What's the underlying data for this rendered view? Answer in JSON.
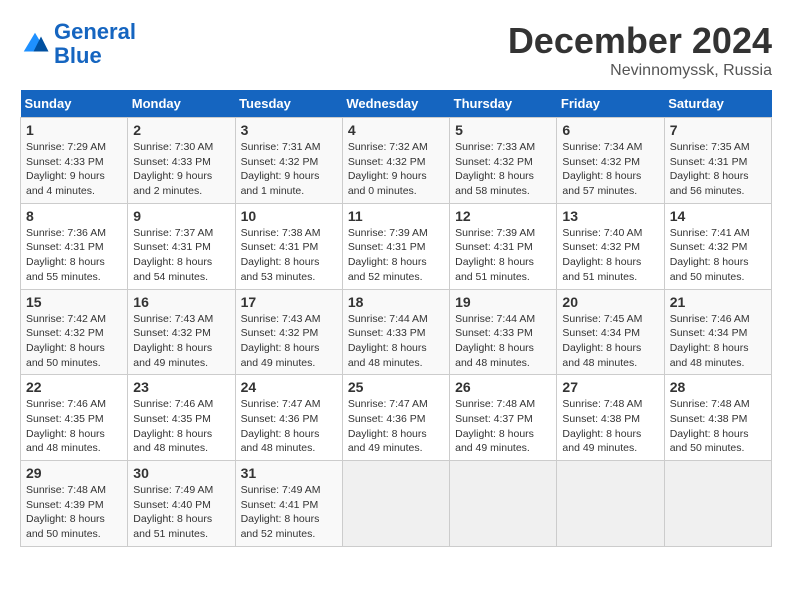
{
  "header": {
    "logo_line1": "General",
    "logo_line2": "Blue",
    "month": "December 2024",
    "location": "Nevinnomyssk, Russia"
  },
  "days_of_week": [
    "Sunday",
    "Monday",
    "Tuesday",
    "Wednesday",
    "Thursday",
    "Friday",
    "Saturday"
  ],
  "weeks": [
    [
      {
        "day": "1",
        "sunrise": "7:29 AM",
        "sunset": "4:33 PM",
        "daylight": "9 hours and 4 minutes."
      },
      {
        "day": "2",
        "sunrise": "7:30 AM",
        "sunset": "4:33 PM",
        "daylight": "9 hours and 2 minutes."
      },
      {
        "day": "3",
        "sunrise": "7:31 AM",
        "sunset": "4:32 PM",
        "daylight": "9 hours and 1 minute."
      },
      {
        "day": "4",
        "sunrise": "7:32 AM",
        "sunset": "4:32 PM",
        "daylight": "9 hours and 0 minutes."
      },
      {
        "day": "5",
        "sunrise": "7:33 AM",
        "sunset": "4:32 PM",
        "daylight": "8 hours and 58 minutes."
      },
      {
        "day": "6",
        "sunrise": "7:34 AM",
        "sunset": "4:32 PM",
        "daylight": "8 hours and 57 minutes."
      },
      {
        "day": "7",
        "sunrise": "7:35 AM",
        "sunset": "4:31 PM",
        "daylight": "8 hours and 56 minutes."
      }
    ],
    [
      {
        "day": "8",
        "sunrise": "7:36 AM",
        "sunset": "4:31 PM",
        "daylight": "8 hours and 55 minutes."
      },
      {
        "day": "9",
        "sunrise": "7:37 AM",
        "sunset": "4:31 PM",
        "daylight": "8 hours and 54 minutes."
      },
      {
        "day": "10",
        "sunrise": "7:38 AM",
        "sunset": "4:31 PM",
        "daylight": "8 hours and 53 minutes."
      },
      {
        "day": "11",
        "sunrise": "7:39 AM",
        "sunset": "4:31 PM",
        "daylight": "8 hours and 52 minutes."
      },
      {
        "day": "12",
        "sunrise": "7:39 AM",
        "sunset": "4:31 PM",
        "daylight": "8 hours and 51 minutes."
      },
      {
        "day": "13",
        "sunrise": "7:40 AM",
        "sunset": "4:32 PM",
        "daylight": "8 hours and 51 minutes."
      },
      {
        "day": "14",
        "sunrise": "7:41 AM",
        "sunset": "4:32 PM",
        "daylight": "8 hours and 50 minutes."
      }
    ],
    [
      {
        "day": "15",
        "sunrise": "7:42 AM",
        "sunset": "4:32 PM",
        "daylight": "8 hours and 50 minutes."
      },
      {
        "day": "16",
        "sunrise": "7:43 AM",
        "sunset": "4:32 PM",
        "daylight": "8 hours and 49 minutes."
      },
      {
        "day": "17",
        "sunrise": "7:43 AM",
        "sunset": "4:32 PM",
        "daylight": "8 hours and 49 minutes."
      },
      {
        "day": "18",
        "sunrise": "7:44 AM",
        "sunset": "4:33 PM",
        "daylight": "8 hours and 48 minutes."
      },
      {
        "day": "19",
        "sunrise": "7:44 AM",
        "sunset": "4:33 PM",
        "daylight": "8 hours and 48 minutes."
      },
      {
        "day": "20",
        "sunrise": "7:45 AM",
        "sunset": "4:34 PM",
        "daylight": "8 hours and 48 minutes."
      },
      {
        "day": "21",
        "sunrise": "7:46 AM",
        "sunset": "4:34 PM",
        "daylight": "8 hours and 48 minutes."
      }
    ],
    [
      {
        "day": "22",
        "sunrise": "7:46 AM",
        "sunset": "4:35 PM",
        "daylight": "8 hours and 48 minutes."
      },
      {
        "day": "23",
        "sunrise": "7:46 AM",
        "sunset": "4:35 PM",
        "daylight": "8 hours and 48 minutes."
      },
      {
        "day": "24",
        "sunrise": "7:47 AM",
        "sunset": "4:36 PM",
        "daylight": "8 hours and 48 minutes."
      },
      {
        "day": "25",
        "sunrise": "7:47 AM",
        "sunset": "4:36 PM",
        "daylight": "8 hours and 49 minutes."
      },
      {
        "day": "26",
        "sunrise": "7:48 AM",
        "sunset": "4:37 PM",
        "daylight": "8 hours and 49 minutes."
      },
      {
        "day": "27",
        "sunrise": "7:48 AM",
        "sunset": "4:38 PM",
        "daylight": "8 hours and 49 minutes."
      },
      {
        "day": "28",
        "sunrise": "7:48 AM",
        "sunset": "4:38 PM",
        "daylight": "8 hours and 50 minutes."
      }
    ],
    [
      {
        "day": "29",
        "sunrise": "7:48 AM",
        "sunset": "4:39 PM",
        "daylight": "8 hours and 50 minutes."
      },
      {
        "day": "30",
        "sunrise": "7:49 AM",
        "sunset": "4:40 PM",
        "daylight": "8 hours and 51 minutes."
      },
      {
        "day": "31",
        "sunrise": "7:49 AM",
        "sunset": "4:41 PM",
        "daylight": "8 hours and 52 minutes."
      },
      null,
      null,
      null,
      null
    ]
  ]
}
